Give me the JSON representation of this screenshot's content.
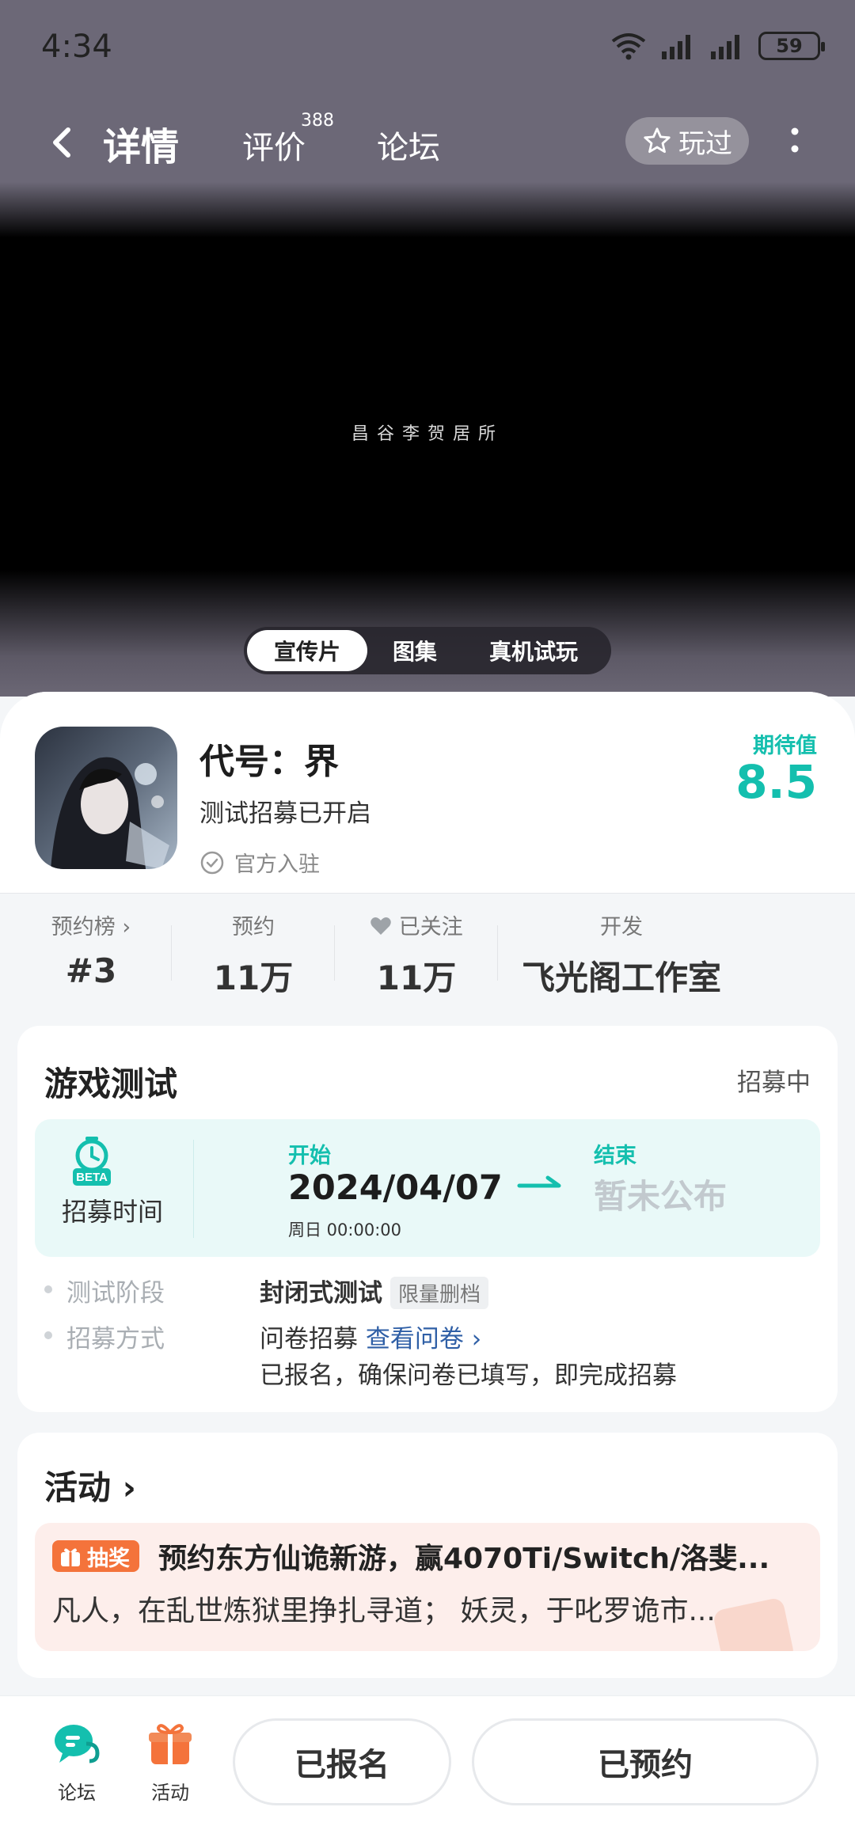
{
  "status_bar": {
    "time": "4:34",
    "battery": "59"
  },
  "nav": {
    "tab_detail": "详情",
    "tab_review": "评价",
    "review_count": "388",
    "tab_forum": "论坛",
    "played_label": "玩过"
  },
  "video": {
    "watermark": "昌谷李贺居所"
  },
  "media_tabs": {
    "promo": "宣传片",
    "gallery": "图集",
    "trial": "真机试玩",
    "active": "宣传片"
  },
  "game": {
    "title": "代号：界",
    "subtitle": "测试招募已开启",
    "official": "官方入驻",
    "expect_label": "期待值",
    "expect_value": "8.5"
  },
  "stats": {
    "rank_label": "预约榜",
    "rank_value": "#3",
    "reserve_label": "预约",
    "reserve_value": "11万",
    "follow_label": "已关注",
    "follow_value": "11万",
    "dev_label": "开发",
    "dev_value": "飞光阁工作室"
  },
  "test": {
    "title": "游戏测试",
    "status": "招募中",
    "recruit_label": "招募时间",
    "beta": "BETA",
    "start_label": "开始",
    "start_date": "2024/04/07",
    "start_time": "周日  00:00:00",
    "end_label": "结束",
    "end_value": "暂未公布",
    "phase_key": "测试阶段",
    "phase_value": "封闭式测试",
    "phase_tag": "限量删档",
    "method_key": "招募方式",
    "method_value": "问卷招募",
    "method_link": "查看问卷",
    "method_note": "已报名，确保问卷已填写，即完成招募"
  },
  "activity": {
    "title": "活动",
    "badge": "抽奖",
    "headline": "预约东方仙诡新游，赢4070Ti/Switch/洛斐...",
    "desc": "凡人，在乱世炼狱里挣扎寻道；  妖灵，于叱罗诡市..."
  },
  "bottom": {
    "forum_label": "论坛",
    "activity_label": "活动",
    "registered_button": "已报名",
    "reserved_button": "已预约"
  },
  "colors": {
    "accent": "#14bfae",
    "orange": "#f4733b",
    "link": "#2f5fa6"
  }
}
